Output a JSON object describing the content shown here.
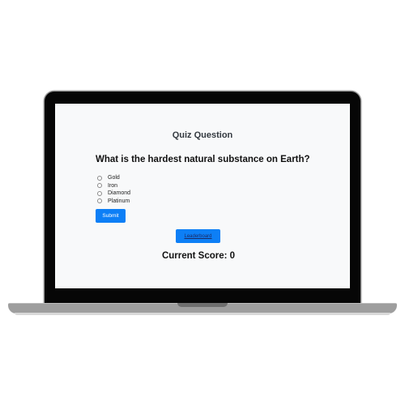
{
  "quiz": {
    "heading": "Quiz Question",
    "question": "What is the hardest natural substance on Earth?",
    "options": [
      {
        "label": "Gold"
      },
      {
        "label": "Iron"
      },
      {
        "label": "Diamond"
      },
      {
        "label": "Platinum"
      }
    ],
    "submit_label": "Submit",
    "leaderboard_label": "Leaderboard",
    "score_text": "Current Score: 0"
  },
  "colors": {
    "button_primary": "#0d7ff6",
    "screen_background": "#f8f9fa",
    "bezel": "#060606",
    "laptop_base": "#9e9e9e"
  }
}
